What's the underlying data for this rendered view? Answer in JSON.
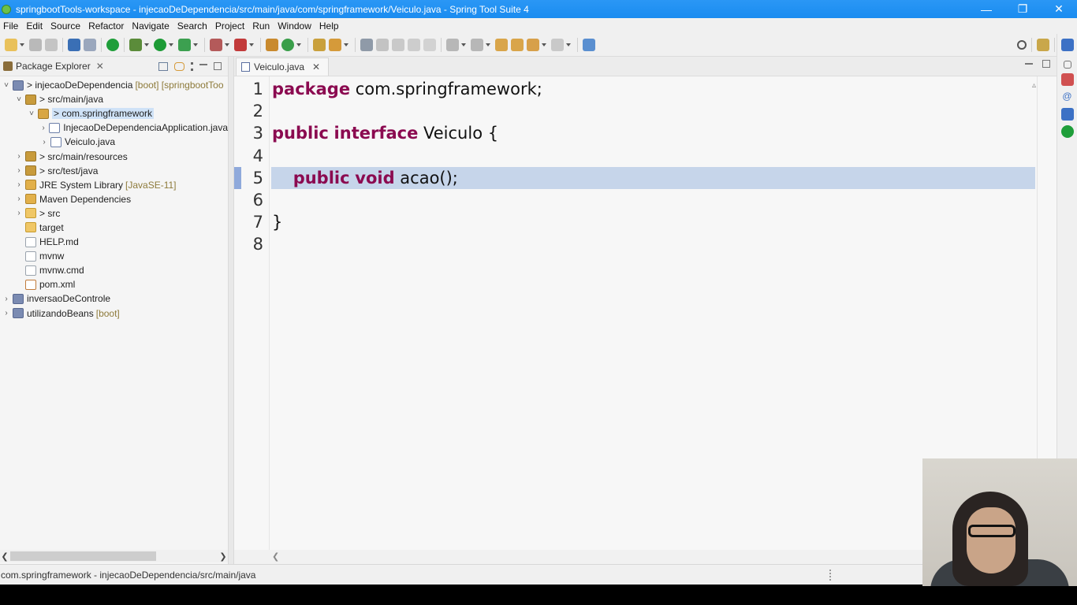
{
  "window": {
    "title": "springbootTools-workspace - injecaoDeDependencia/src/main/java/com/springframework/Veiculo.java - Spring Tool Suite 4",
    "controls": [
      "—",
      "❐",
      "✕"
    ]
  },
  "menubar": {
    "items": [
      "File",
      "Edit",
      "Source",
      "Refactor",
      "Navigate",
      "Search",
      "Project",
      "Run",
      "Window",
      "Help"
    ]
  },
  "package_explorer": {
    "title": "Package Explorer",
    "close": "✕",
    "tree": [
      {
        "label": "> injecaoDeDependencia",
        "extra": "[boot] [springbootToo",
        "indent": 0,
        "twisty": "˅",
        "icon": "proj"
      },
      {
        "label": "> src/main/java",
        "extra": "",
        "indent": 1,
        "twisty": "˅",
        "icon": "pkgfolder"
      },
      {
        "label": "> com.springframework",
        "extra": "",
        "indent": 2,
        "twisty": "˅",
        "icon": "pkg",
        "selected": true
      },
      {
        "label": "InjecaoDeDependenciaApplication.java",
        "extra": "",
        "indent": 3,
        "twisty": "›",
        "icon": "jfile"
      },
      {
        "label": "Veiculo.java",
        "extra": "",
        "indent": 3,
        "twisty": "›",
        "icon": "jfile"
      },
      {
        "label": "> src/main/resources",
        "extra": "",
        "indent": 1,
        "twisty": "›",
        "icon": "pkgfolder"
      },
      {
        "label": "> src/test/java",
        "extra": "",
        "indent": 1,
        "twisty": "›",
        "icon": "pkgfolder"
      },
      {
        "label": "JRE System Library",
        "extra": "[JavaSE-11]",
        "indent": 1,
        "twisty": "›",
        "icon": "lib"
      },
      {
        "label": "Maven Dependencies",
        "extra": "",
        "indent": 1,
        "twisty": "›",
        "icon": "lib"
      },
      {
        "label": "> src",
        "extra": "",
        "indent": 1,
        "twisty": "›",
        "icon": "folder"
      },
      {
        "label": "target",
        "extra": "",
        "indent": 1,
        "twisty": "",
        "icon": "folder"
      },
      {
        "label": "HELP.md",
        "extra": "",
        "indent": 1,
        "twisty": "",
        "icon": "file"
      },
      {
        "label": "mvnw",
        "extra": "",
        "indent": 1,
        "twisty": "",
        "icon": "file"
      },
      {
        "label": "mvnw.cmd",
        "extra": "",
        "indent": 1,
        "twisty": "",
        "icon": "file"
      },
      {
        "label": "pom.xml",
        "extra": "",
        "indent": 1,
        "twisty": "",
        "icon": "xml"
      },
      {
        "label": "inversaoDeControle",
        "extra": "",
        "indent": 0,
        "twisty": "›",
        "icon": "proj"
      },
      {
        "label": "utilizandoBeans",
        "extra": "[boot]",
        "indent": 0,
        "twisty": "›",
        "icon": "proj"
      }
    ]
  },
  "editor": {
    "tab_label": "Veiculo.java",
    "tab_close": "✕",
    "current_line": 5,
    "lines": [
      {
        "n": "1",
        "tokens": [
          {
            "t": "package",
            "kw": true
          },
          {
            "t": " com.springframework;",
            "kw": false
          }
        ]
      },
      {
        "n": "2",
        "tokens": []
      },
      {
        "n": "3",
        "tokens": [
          {
            "t": "public",
            "kw": true
          },
          {
            "t": " ",
            "kw": false
          },
          {
            "t": "interface",
            "kw": true
          },
          {
            "t": " Veiculo {",
            "kw": false
          }
        ]
      },
      {
        "n": "4",
        "tokens": []
      },
      {
        "n": "5",
        "tokens": [
          {
            "t": "    ",
            "kw": false
          },
          {
            "t": "public",
            "kw": true
          },
          {
            "t": " ",
            "kw": false
          },
          {
            "t": "void",
            "kw": true
          },
          {
            "t": " acao();",
            "kw": false
          }
        ]
      },
      {
        "n": "6",
        "tokens": []
      },
      {
        "n": "7",
        "tokens": [
          {
            "t": "}",
            "kw": false
          }
        ]
      },
      {
        "n": "8",
        "tokens": []
      }
    ]
  },
  "status_bar": {
    "text": "com.springframework - injecaoDeDependencia/src/main/java"
  },
  "colors": {
    "keyword": "#8b0a50",
    "title_bar": "#1a8cf0",
    "current_line": "#c6d5ea"
  }
}
